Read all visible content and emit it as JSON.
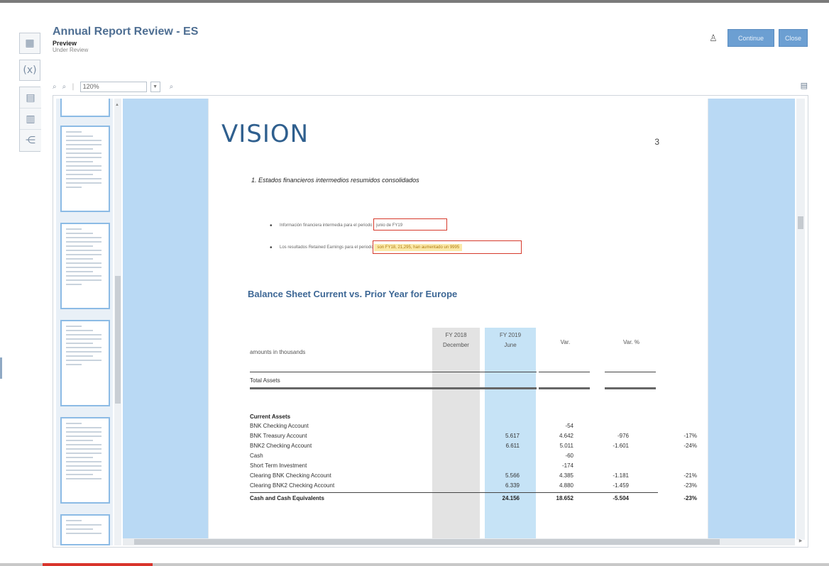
{
  "app": {
    "title": "Annual Report Review - ES",
    "subtitle": "Preview",
    "status": "Under Review",
    "actions": {
      "primary_label": "Continue",
      "secondary_label": "Close"
    }
  },
  "icons": {
    "rail": [
      "grid-icon",
      "variable-icon",
      "document-icon",
      "documents-icon",
      "tree-icon"
    ],
    "person": "person-icon"
  },
  "rail_labels": {
    "variable": "(x)"
  },
  "toolbar": {
    "zoom_value": "120%"
  },
  "document": {
    "logo": "VISION",
    "page_number": "3",
    "section_heading": "1.   Estados financieros intermedios resumidos consolidados",
    "bullet_1_text": "Información financiera intermedia para el periodo",
    "bullet_1_highlight": "junio de FY19",
    "bullet_2_text": "Los resultados Retained Earnings para el periodo",
    "bullet_2_highlight": "son FY18, 21,295, han aumentado un 9995",
    "sheet_title": "Balance Sheet Current vs. Prior Year for Europe",
    "table": {
      "amounts_label": "amounts in thousands",
      "columns": [
        {
          "line1": "FY 2018",
          "line2": "December"
        },
        {
          "line1": "FY 2019",
          "line2": "June"
        },
        {
          "line1": "Var.",
          "line2": ""
        },
        {
          "line1": "Var. %",
          "line2": ""
        }
      ],
      "total_assets_label": "Total Assets",
      "current_assets_label": "Current Assets",
      "rows": [
        {
          "label": "BNK Checking Account",
          "c1": "",
          "c2": "-54",
          "c3": "",
          "c4": ""
        },
        {
          "label": "BNK Treasury Account",
          "c1": "5.617",
          "c2": "4.642",
          "c3": "-976",
          "c4": "-17%"
        },
        {
          "label": "BNK2 Checking Account",
          "c1": "6.611",
          "c2": "5.011",
          "c3": "-1.601",
          "c4": "-24%"
        },
        {
          "label": "Cash",
          "c1": "",
          "c2": "-60",
          "c3": "",
          "c4": ""
        },
        {
          "label": "Short Term Investment",
          "c1": "",
          "c2": "-174",
          "c3": "",
          "c4": ""
        },
        {
          "label": "Clearing BNK Checking Account",
          "c1": "5.566",
          "c2": "4.385",
          "c3": "-1.181",
          "c4": "-21%"
        },
        {
          "label": "Clearing BNK2 Checking Account",
          "c1": "6.339",
          "c2": "4.880",
          "c3": "-1.459",
          "c4": "-23%"
        }
      ],
      "total_row": {
        "label": "Cash and Cash Equivalents",
        "c1": "24.156",
        "c2": "18.652",
        "c3": "-5.504",
        "c4": "-23%"
      }
    }
  },
  "colors": {
    "title": "#4f6f93",
    "button": "#6c9fd2",
    "page_background": "#b9d9f4",
    "highlight_border": "#d63a2c",
    "highlight_fill": "#fbe9a8"
  }
}
